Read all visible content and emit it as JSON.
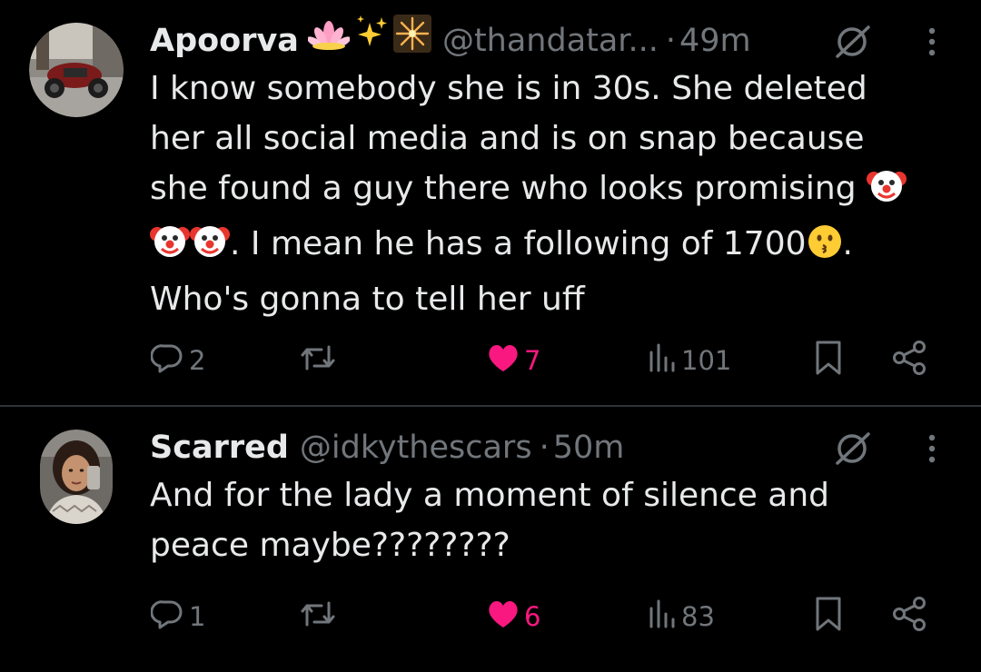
{
  "colors": {
    "background": "#000000",
    "text_primary": "#e7e9ea",
    "text_secondary": "#71767b",
    "like_active": "#f91880",
    "divider": "#2f3336"
  },
  "tweets": [
    {
      "author_name": "Apoorva",
      "name_emojis": [
        "lotus",
        "sparkles",
        "sparkler"
      ],
      "handle": "@thandatar...",
      "separator": "·",
      "time": "49m",
      "text_lines": [
        "I know somebody she is in  30s. She deleted",
        "her all social media and is on snap because",
        "she found a guy there who looks promising",
        ". I mean he has a following of 1700",
        "Who's gonna to tell her uff"
      ],
      "text_line4_suffix": ".",
      "stats": {
        "replies": "2",
        "likes": "7",
        "views": "101"
      },
      "like_active": true
    },
    {
      "author_name": "Scarred",
      "handle": "@idkythescars",
      "separator": "·",
      "time": "50m",
      "text_lines": [
        "And for the lady a moment of silence and",
        "peace maybe????????"
      ],
      "stats": {
        "replies": "1",
        "likes": "6",
        "views": "83"
      },
      "like_active": true
    }
  ],
  "icons": {
    "reply": "reply-icon",
    "retweet": "retweet-icon",
    "like": "heart-icon",
    "views": "views-icon",
    "bookmark": "bookmark-icon",
    "share": "share-icon",
    "grok": "grok-icon",
    "more": "more-icon",
    "clown": "clown-face-emoji",
    "kissing": "kissing-face-emoji"
  }
}
